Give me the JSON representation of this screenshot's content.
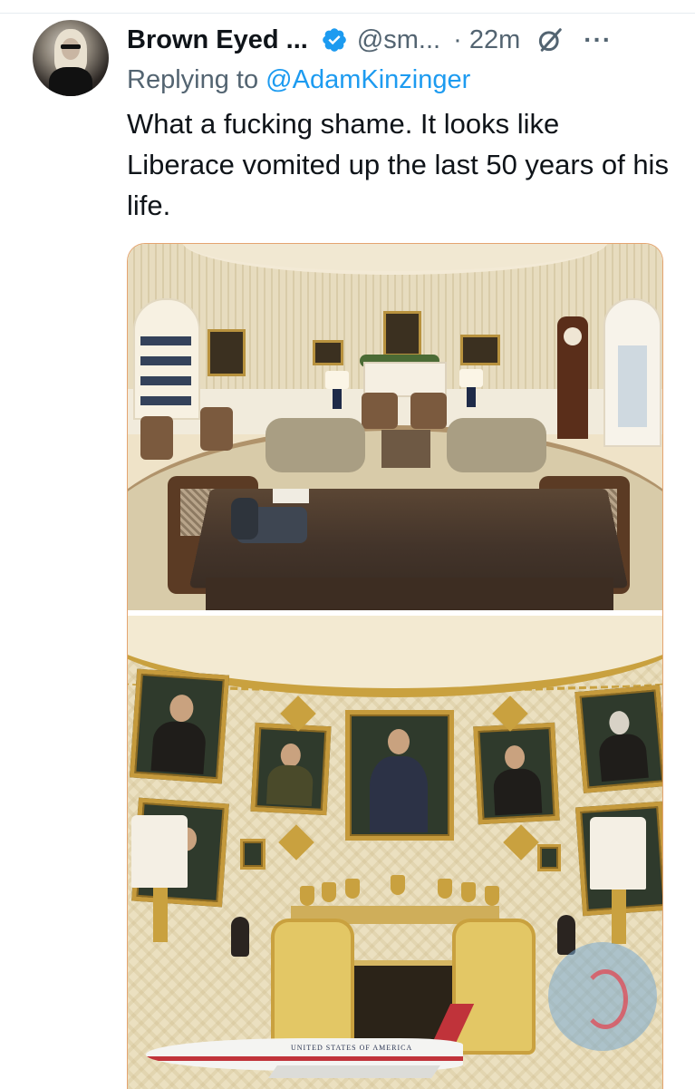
{
  "tweet": {
    "display_name": "Brown Eyed ...",
    "handle": "@sm...",
    "time": "· 22m",
    "more": "···",
    "reply_prefix": "Replying to",
    "reply_to": "@AdamKinzinger",
    "text": "What a fucking shame. It looks like Liberace vomited up the last 50 years of his life."
  },
  "icons": {
    "verified": "verified-badge-icon",
    "grok": "grok-icon",
    "more": "more-icon"
  },
  "media": {
    "airplane_text": "UNITED STATES OF AMERICA"
  },
  "colors": {
    "text": "#0f1419",
    "secondary": "#536471",
    "link": "#1d9bf0",
    "verified": "#1d9bf0"
  }
}
